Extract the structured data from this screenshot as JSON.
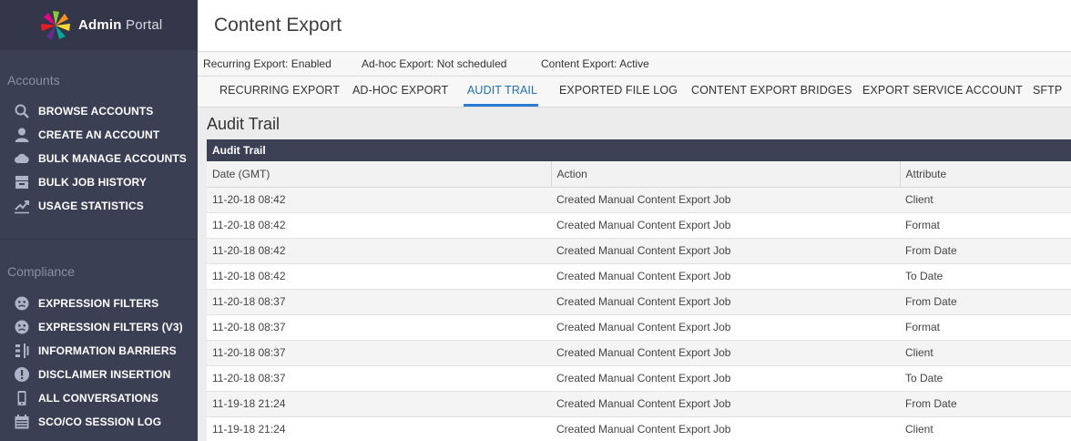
{
  "brand": {
    "name_bold": "Admin",
    "name_light": "Portal"
  },
  "sidebar": {
    "accounts_title": "Accounts",
    "accounts_items": [
      {
        "label": "BROWSE ACCOUNTS",
        "icon": "search-icon"
      },
      {
        "label": "CREATE AN ACCOUNT",
        "icon": "user-icon"
      },
      {
        "label": "BULK MANAGE ACCOUNTS",
        "icon": "cloud-icon"
      },
      {
        "label": "BULK JOB HISTORY",
        "icon": "archive-icon"
      },
      {
        "label": "USAGE STATISTICS",
        "icon": "trend-chart-icon"
      }
    ],
    "compliance_title": "Compliance",
    "compliance_items": [
      {
        "label": "EXPRESSION FILTERS",
        "icon": "filter-face-icon"
      },
      {
        "label": "EXPRESSION FILTERS (V3)",
        "icon": "filter-face-icon"
      },
      {
        "label": "INFORMATION BARRIERS",
        "icon": "barrier-icon"
      },
      {
        "label": "DISCLAIMER INSERTION",
        "icon": "alert-icon"
      },
      {
        "label": "ALL CONVERSATIONS",
        "icon": "phone-icon"
      },
      {
        "label": "SCO/CO SESSION LOG",
        "icon": "calendar-icon"
      }
    ]
  },
  "header": {
    "title": "Content Export"
  },
  "status": {
    "recurring_label": "Recurring Export:",
    "recurring_value": "Enabled",
    "adhoc_label": "Ad-hoc Export:",
    "adhoc_value": "Not scheduled",
    "content_label": "Content Export:",
    "content_value": "Active"
  },
  "tabs": [
    {
      "label": "RECURRING EXPORT"
    },
    {
      "label": "AD-HOC EXPORT"
    },
    {
      "label": "AUDIT TRAIL",
      "active": true
    },
    {
      "label": "EXPORTED FILE LOG"
    },
    {
      "label": "CONTENT EXPORT BRIDGES"
    },
    {
      "label": "EXPORT SERVICE ACCOUNT"
    },
    {
      "label": "SFTP"
    }
  ],
  "audit": {
    "heading": "Audit Trail",
    "panel_title": "Audit Trail",
    "columns": [
      "Date (GMT)",
      "Action",
      "Attribute"
    ],
    "rows": [
      [
        "11-20-18 08:42",
        "Created Manual Content Export Job",
        "Client"
      ],
      [
        "11-20-18 08:42",
        "Created Manual Content Export Job",
        "Format"
      ],
      [
        "11-20-18 08:42",
        "Created Manual Content Export Job",
        "From Date"
      ],
      [
        "11-20-18 08:42",
        "Created Manual Content Export Job",
        "To Date"
      ],
      [
        "11-20-18 08:37",
        "Created Manual Content Export Job",
        "From Date"
      ],
      [
        "11-20-18 08:37",
        "Created Manual Content Export Job",
        "Format"
      ],
      [
        "11-20-18 08:37",
        "Created Manual Content Export Job",
        "Client"
      ],
      [
        "11-20-18 08:37",
        "Created Manual Content Export Job",
        "To Date"
      ],
      [
        "11-19-18 21:24",
        "Created Manual Content Export Job",
        "From Date"
      ],
      [
        "11-19-18 21:24",
        "Created Manual Content Export Job",
        "Client"
      ]
    ]
  },
  "colors": {
    "sidebar_bg": "#3b3f53",
    "accent": "#2a7dd1",
    "panel_head": "#3c4054"
  }
}
